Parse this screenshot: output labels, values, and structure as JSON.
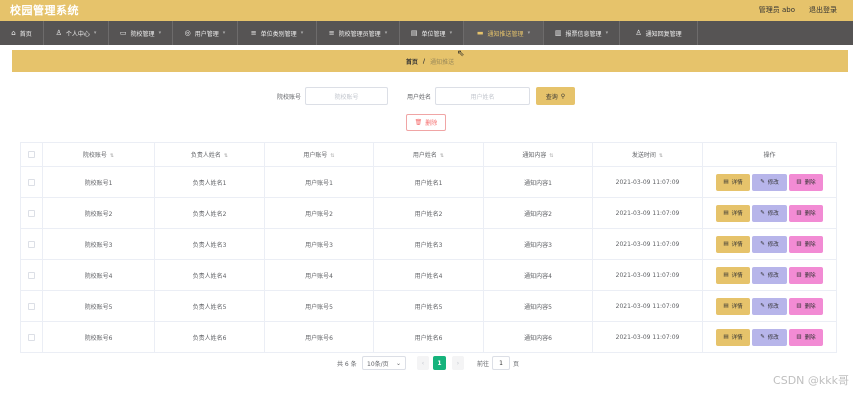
{
  "app": {
    "title": "校园管理系统",
    "user": "管理员 abo",
    "logout": "退出登录"
  },
  "nav": [
    {
      "icon": "home-icon",
      "glyph": "⌂",
      "label": "首页",
      "caret": false,
      "active": false
    },
    {
      "icon": "user-icon",
      "glyph": "♙",
      "label": "个人中心",
      "caret": true,
      "active": false
    },
    {
      "icon": "school-icon",
      "glyph": "▭",
      "label": "院校管理",
      "caret": true,
      "active": false
    },
    {
      "icon": "user-circle-icon",
      "glyph": "◎",
      "label": "用户管理",
      "caret": true,
      "active": false
    },
    {
      "icon": "menu-icon",
      "glyph": "≡",
      "label": "单位类别管理",
      "caret": true,
      "active": false
    },
    {
      "icon": "list-icon",
      "glyph": "≡",
      "label": "院校管理员管理",
      "caret": true,
      "active": false
    },
    {
      "icon": "unit-icon",
      "glyph": "▤",
      "label": "单位管理",
      "caret": true,
      "active": false
    },
    {
      "icon": "notice-icon",
      "glyph": "▬",
      "label": "通知推送管理",
      "caret": true,
      "active": true
    },
    {
      "icon": "report-icon",
      "glyph": "▥",
      "label": "报票信息管理",
      "caret": true,
      "active": false
    },
    {
      "icon": "person-icon",
      "glyph": "♙",
      "label": "通知回复管理",
      "caret": true,
      "active": false
    }
  ],
  "breadcrumb": {
    "home": "首页",
    "sep": "/",
    "current": "通知推送"
  },
  "search": {
    "label1": "院校账号",
    "placeholder1": "院校账号",
    "label2": "用户姓名",
    "placeholder2": "用户姓名",
    "button": "查询"
  },
  "delete_button": "删除",
  "table": {
    "headers": [
      "院校账号",
      "负责人姓名",
      "用户账号",
      "用户姓名",
      "通知内容",
      "发送时间",
      "操作"
    ],
    "rows": [
      [
        "院校账号1",
        "负责人姓名1",
        "用户账号1",
        "用户姓名1",
        "通知内容1",
        "2021-03-09 11:07:09"
      ],
      [
        "院校账号2",
        "负责人姓名2",
        "用户账号2",
        "用户姓名2",
        "通知内容2",
        "2021-03-09 11:07:09"
      ],
      [
        "院校账号3",
        "负责人姓名3",
        "用户账号3",
        "用户姓名3",
        "通知内容3",
        "2021-03-09 11:07:09"
      ],
      [
        "院校账号4",
        "负责人姓名4",
        "用户账号4",
        "用户姓名4",
        "通知内容4",
        "2021-03-09 11:07:09"
      ],
      [
        "院校账号5",
        "负责人姓名5",
        "用户账号5",
        "用户姓名5",
        "通知内容5",
        "2021-03-09 11:07:09"
      ],
      [
        "院校账号6",
        "负责人姓名6",
        "用户账号6",
        "用户姓名6",
        "通知内容6",
        "2021-03-09 11:07:09"
      ]
    ],
    "actions": {
      "detail": "详情",
      "edit": "修改",
      "delete": "删除"
    }
  },
  "pagination": {
    "total": "共 6 条",
    "page_size": "10条/页",
    "prev": "‹",
    "current_page": "1",
    "next": "›",
    "goto": "前往",
    "goto_value": "1",
    "page_suffix": "页"
  },
  "watermark": "CSDN @kkk哥",
  "colors": {
    "accent": "#e6c36b",
    "nav_bg": "#565454",
    "detail": "#e6c36b",
    "edit": "#b7b5ea",
    "delete": "#f28bd4",
    "page_active": "#16b37c"
  }
}
